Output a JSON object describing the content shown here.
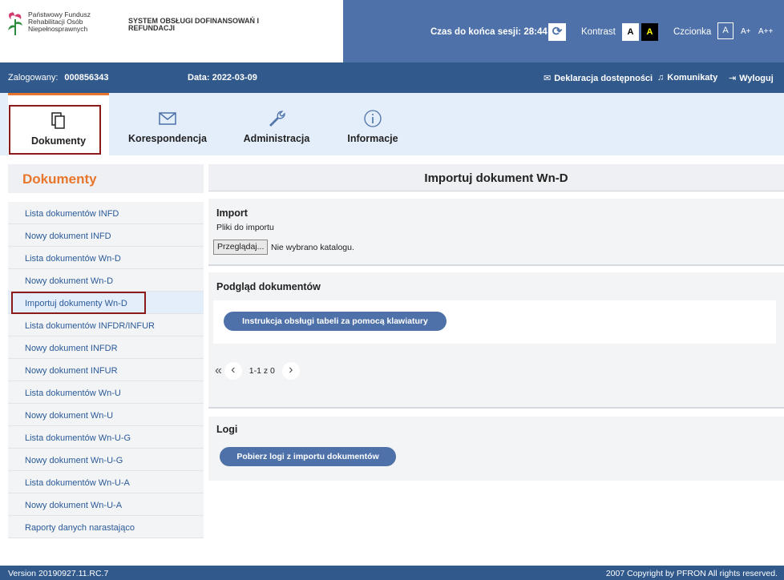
{
  "header": {
    "logo_text": "Państwowy Fundusz Rehabilitacji Osób Niepełnosprawnych",
    "system_title": "SYSTEM OBSŁUGI DOFINANSOWAŃ I REFUNDACJI",
    "session_label": "Czas do końca sesji:",
    "session_time": "28:44",
    "contrast_label": "Kontrast",
    "contrast_white": "A",
    "contrast_black": "A",
    "font_label": "Czcionka",
    "font_normal": "A",
    "font_large": "A+",
    "font_xlarge": "A++",
    "brand_color": "#4d71a8",
    "accent_color": "#e8762c"
  },
  "userbar": {
    "logged_label": "Zalogowany:",
    "user_id": "000856343",
    "date_label": "Data:",
    "date_value": "2022-03-09",
    "declaration": "Deklaracja dostępności",
    "messages": "Komunikaty",
    "logout": "Wyloguj"
  },
  "tabs": [
    {
      "label": "Dokumenty",
      "icon": "documents-icon",
      "active": true
    },
    {
      "label": "Korespondencja",
      "icon": "envelope-icon",
      "active": false
    },
    {
      "label": "Administracja",
      "icon": "wrench-icon",
      "active": false
    },
    {
      "label": "Informacje",
      "icon": "info-icon",
      "active": false
    }
  ],
  "sidebar": {
    "title": "Dokumenty",
    "items": [
      {
        "label": "Lista dokumentów INFD"
      },
      {
        "label": "Nowy dokument INFD"
      },
      {
        "label": "Lista dokumentów Wn-D"
      },
      {
        "label": "Nowy dokument Wn-D"
      },
      {
        "label": "Importuj dokumenty Wn-D",
        "active": true
      },
      {
        "label": "Lista dokumentów INFDR/INFUR"
      },
      {
        "label": "Nowy dokument INFDR"
      },
      {
        "label": "Nowy dokument INFUR"
      },
      {
        "label": "Lista dokumentów Wn-U"
      },
      {
        "label": "Nowy dokument Wn-U"
      },
      {
        "label": "Lista dokumentów Wn-U-G"
      },
      {
        "label": "Nowy dokument Wn-U-G"
      },
      {
        "label": "Lista dokumentów Wn-U-A"
      },
      {
        "label": "Nowy dokument Wn-U-A"
      },
      {
        "label": "Raporty danych narastająco"
      }
    ]
  },
  "main": {
    "title": "Importuj dokument Wn-D",
    "import": {
      "heading": "Import",
      "files_label": "Pliki do importu",
      "browse_label": "Przeglądaj...",
      "no_dir": "Nie wybrano katalogu."
    },
    "preview": {
      "heading": "Podgląd dokumentów",
      "instruction_button": "Instrukcja obsługi tabeli za pomocą klawiatury",
      "pager_range": "1-1 z 0"
    },
    "logs": {
      "heading": "Logi",
      "download_button": "Pobierz logi z importu dokumentów"
    }
  },
  "footer": {
    "version": "Version 20190927.11.RC.7",
    "copyright": "2007 Copyright by PFRON All rights reserved."
  }
}
